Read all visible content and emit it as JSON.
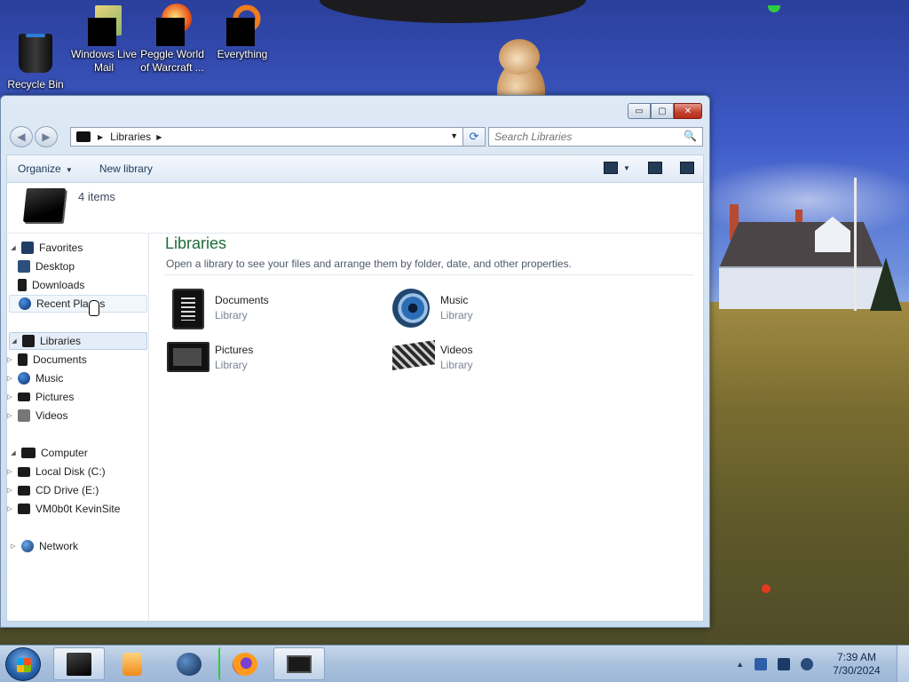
{
  "desktop": {
    "icons": [
      {
        "label": "Recycle Bin",
        "icon": "recycle-bin-icon"
      },
      {
        "label": "Windows Live Mail",
        "icon": "mail-icon"
      },
      {
        "label": "Peggle World of Warcraft ...",
        "icon": "peggle-icon"
      },
      {
        "label": "Everything",
        "icon": "everything-search-icon"
      }
    ]
  },
  "window": {
    "caption_buttons": {
      "minimize": "▭",
      "maximize": "▢",
      "close": "✕"
    },
    "nav": {
      "back": "◀",
      "forward": "▶"
    },
    "address": {
      "segments": [
        "Libraries"
      ],
      "dropdown": "▼",
      "refresh": "⟳"
    },
    "search": {
      "placeholder": "Search Libraries",
      "icon": "🔍"
    },
    "toolbar": {
      "organize": "Organize",
      "new_library": "New library"
    },
    "header": {
      "count": "4 items"
    },
    "navpane": {
      "favorites": {
        "label": "Favorites",
        "items": [
          "Desktop",
          "Downloads",
          "Recent Places"
        ]
      },
      "libraries": {
        "label": "Libraries",
        "items": [
          "Documents",
          "Music",
          "Pictures",
          "Videos"
        ]
      },
      "computer": {
        "label": "Computer",
        "items": [
          "Local Disk (C:)",
          "CD Drive (E:)",
          "VM0b0t KevinSite"
        ]
      },
      "network": {
        "label": "Network"
      }
    },
    "content": {
      "title": "Libraries",
      "subtitle": "Open a library to see your files and arrange them by folder, date, and other properties.",
      "libraries": [
        {
          "name": "Documents",
          "type": "Library",
          "icon": "documents-library-icon"
        },
        {
          "name": "Music",
          "type": "Library",
          "icon": "music-library-icon"
        },
        {
          "name": "Pictures",
          "type": "Library",
          "icon": "pictures-library-icon"
        },
        {
          "name": "Videos",
          "type": "Library",
          "icon": "videos-library-icon"
        }
      ]
    }
  },
  "taskbar": {
    "pinned": [
      "explorer-icon",
      "media-player-icon",
      "network-globe-icon",
      "firefox-icon",
      "display-icon"
    ],
    "tray_arrow": "▲",
    "clock": {
      "time": "7:39 AM",
      "date": "7/30/2024"
    }
  },
  "colors": {
    "accent_title": "#1e6b3a",
    "close_button": "#c2402e",
    "taskbar": "#aac1dd"
  }
}
